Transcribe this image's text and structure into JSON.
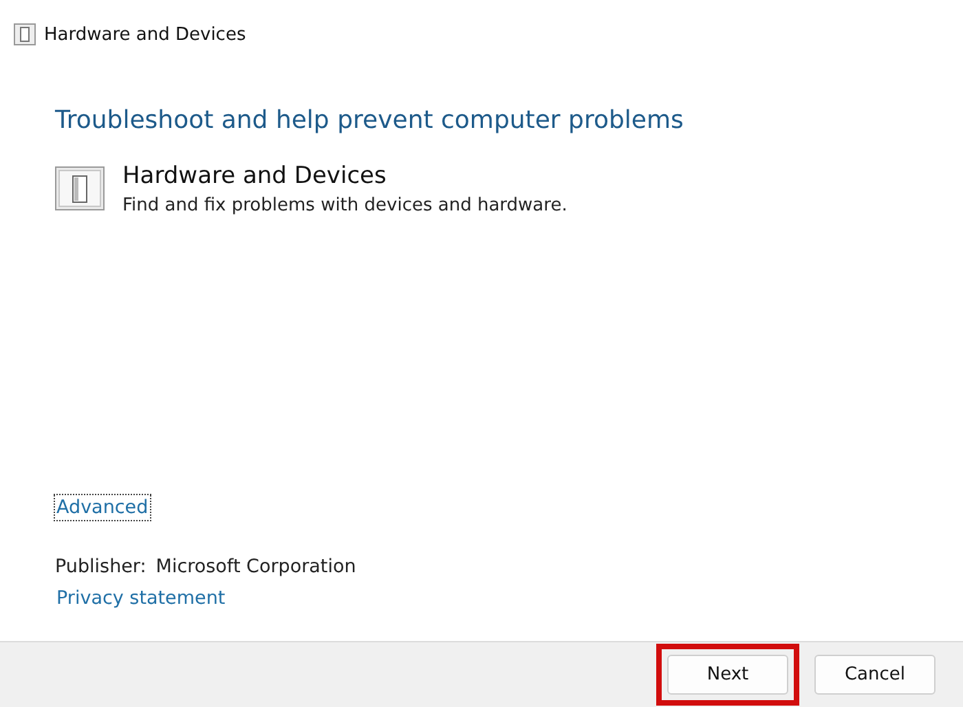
{
  "window": {
    "title": "Hardware and Devices"
  },
  "heading": "Troubleshoot and help prevent computer problems",
  "troubleshooter": {
    "name": "Hardware and Devices",
    "description": "Find and fix problems with devices and hardware."
  },
  "advanced_link": {
    "label": "Advanced",
    "focused": true
  },
  "publisher": {
    "label": "Publisher:",
    "value": "Microsoft Corporation"
  },
  "privacy_link": "Privacy statement",
  "buttons": [
    {
      "label": "Next",
      "highlighted": true
    },
    {
      "label": "Cancel",
      "highlighted": false
    }
  ]
}
